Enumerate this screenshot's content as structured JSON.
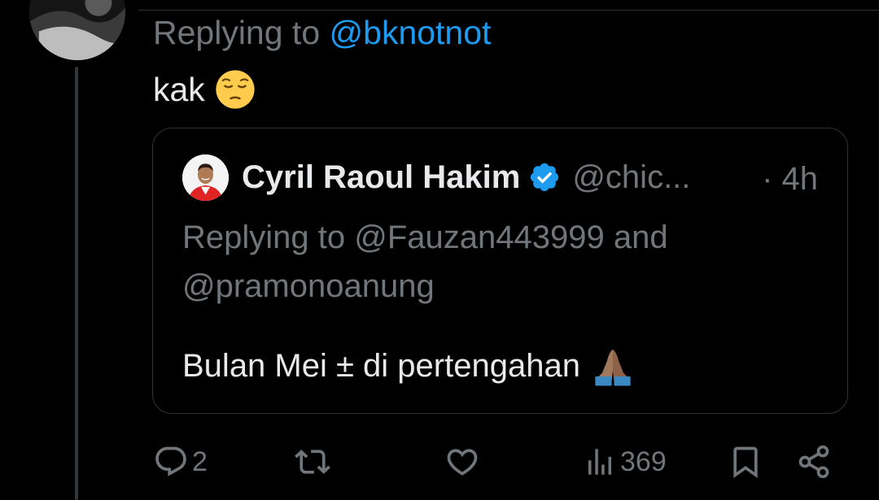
{
  "reply": {
    "replying_prefix": "Replying to ",
    "replying_handle": "@bknotnot",
    "text": "kak",
    "emoji": "pensive-face"
  },
  "quote": {
    "display_name": "Cyril Raoul Hakim",
    "verified": true,
    "handle": "@chic...",
    "time": "· 4h",
    "replying": "Replying to @Fauzan443999 and @pramonoanung",
    "text": "Bulan Mei ± di pertengahan",
    "emoji": "folded-hands"
  },
  "actions": {
    "reply_count": "2",
    "retweet_count": "",
    "like_count": "",
    "views_count": "369"
  },
  "colors": {
    "background": "#000000",
    "text_primary": "#e7e9ea",
    "text_secondary": "#71767b",
    "accent": "#1d9bf0",
    "border": "#2f3336"
  }
}
